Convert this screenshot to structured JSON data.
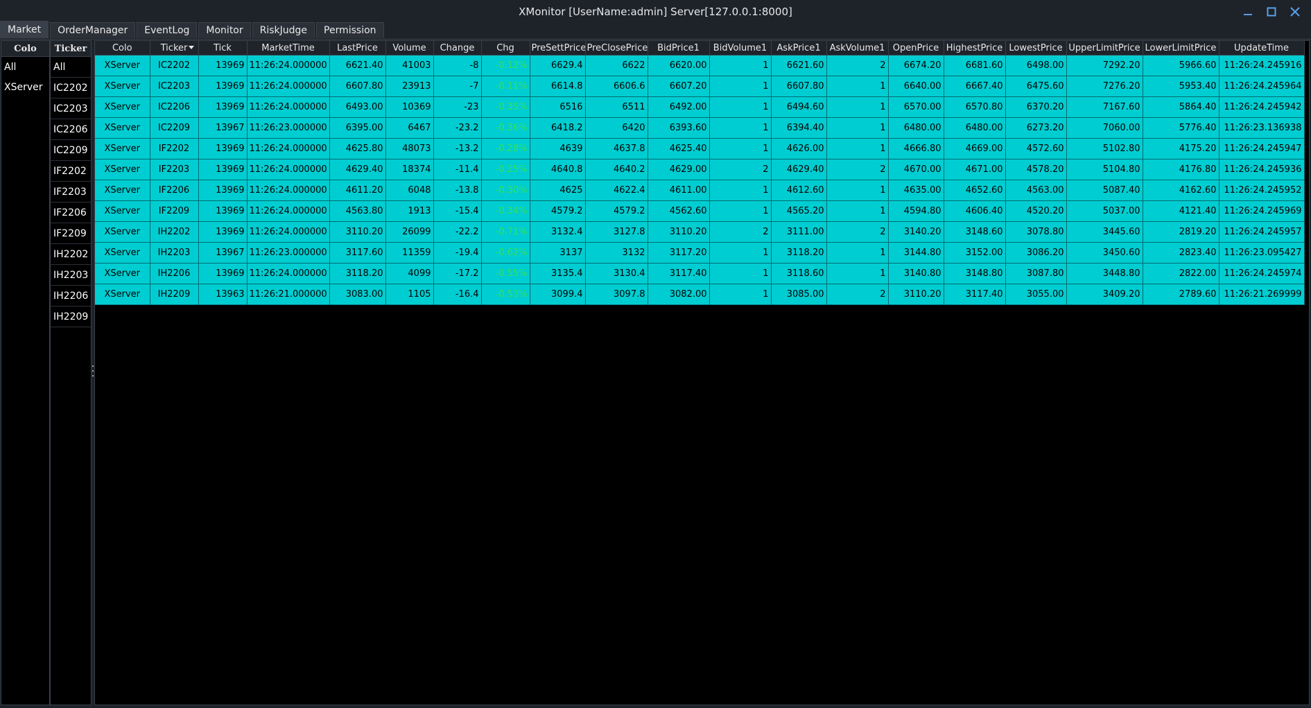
{
  "window": {
    "title": "XMonitor [UserName:admin] Server[127.0.0.1:8000]"
  },
  "tabs": [
    {
      "label": "Market",
      "active": true
    },
    {
      "label": "OrderManager",
      "active": false
    },
    {
      "label": "EventLog",
      "active": false
    },
    {
      "label": "Monitor",
      "active": false
    },
    {
      "label": "RiskJudge",
      "active": false
    },
    {
      "label": "Permission",
      "active": false
    }
  ],
  "colo_filter": {
    "header": "Colo",
    "items": [
      "All",
      "XServer"
    ]
  },
  "ticker_filter": {
    "header": "Ticker",
    "items": [
      "All",
      "IC2202",
      "IC2203",
      "IC2206",
      "IC2209",
      "IF2202",
      "IF2203",
      "IF2206",
      "IF2209",
      "IH2202",
      "IH2203",
      "IH2206",
      "IH2209"
    ]
  },
  "market_table": {
    "sorted_column": "Ticker",
    "columns": [
      "Colo",
      "Ticker",
      "Tick",
      "MarketTime",
      "LastPrice",
      "Volume",
      "Change",
      "Chg",
      "PreSettPrice",
      "PreClosePrice",
      "BidPrice1",
      "BidVolume1",
      "AskPrice1",
      "AskVolume1",
      "OpenPrice",
      "HighestPrice",
      "LowestPrice",
      "UpperLimitPrice",
      "LowerLimitPrice",
      "UpdateTime"
    ],
    "rows": [
      [
        "XServer",
        "IC2202",
        "13969",
        "11:26:24.000000",
        "6621.40",
        "41003",
        "-8",
        "-0.12%",
        "6629.4",
        "6622",
        "6620.00",
        "1",
        "6621.60",
        "2",
        "6674.20",
        "6681.60",
        "6498.00",
        "7292.20",
        "5966.60",
        "11:26:24.245916"
      ],
      [
        "XServer",
        "IC2203",
        "13969",
        "11:26:24.000000",
        "6607.80",
        "23913",
        "-7",
        "-0.11%",
        "6614.8",
        "6606.6",
        "6607.20",
        "1",
        "6607.80",
        "1",
        "6640.00",
        "6667.40",
        "6475.60",
        "7276.20",
        "5953.40",
        "11:26:24.245964"
      ],
      [
        "XServer",
        "IC2206",
        "13969",
        "11:26:24.000000",
        "6493.00",
        "10369",
        "-23",
        "-0.35%",
        "6516",
        "6511",
        "6492.00",
        "1",
        "6494.60",
        "1",
        "6570.00",
        "6570.80",
        "6370.20",
        "7167.60",
        "5864.40",
        "11:26:24.245942"
      ],
      [
        "XServer",
        "IC2209",
        "13967",
        "11:26:23.000000",
        "6395.00",
        "6467",
        "-23.2",
        "-0.36%",
        "6418.2",
        "6420",
        "6393.60",
        "1",
        "6394.40",
        "1",
        "6480.00",
        "6480.00",
        "6273.20",
        "7060.00",
        "5776.40",
        "11:26:23.136938"
      ],
      [
        "XServer",
        "IF2202",
        "13969",
        "11:26:24.000000",
        "4625.80",
        "48073",
        "-13.2",
        "-0.28%",
        "4639",
        "4637.8",
        "4625.40",
        "1",
        "4626.00",
        "1",
        "4666.80",
        "4669.00",
        "4572.60",
        "5102.80",
        "4175.20",
        "11:26:24.245947"
      ],
      [
        "XServer",
        "IF2203",
        "13969",
        "11:26:24.000000",
        "4629.40",
        "18374",
        "-11.4",
        "-0.25%",
        "4640.8",
        "4640.2",
        "4629.00",
        "2",
        "4629.40",
        "2",
        "4670.00",
        "4671.00",
        "4578.20",
        "5104.80",
        "4176.80",
        "11:26:24.245936"
      ],
      [
        "XServer",
        "IF2206",
        "13969",
        "11:26:24.000000",
        "4611.20",
        "6048",
        "-13.8",
        "-0.30%",
        "4625",
        "4622.4",
        "4611.00",
        "1",
        "4612.60",
        "1",
        "4635.00",
        "4652.60",
        "4563.00",
        "5087.40",
        "4162.60",
        "11:26:24.245952"
      ],
      [
        "XServer",
        "IF2209",
        "13969",
        "11:26:24.000000",
        "4563.80",
        "1913",
        "-15.4",
        "-0.34%",
        "4579.2",
        "4579.2",
        "4562.60",
        "1",
        "4565.20",
        "1",
        "4594.80",
        "4606.40",
        "4520.20",
        "5037.00",
        "4121.40",
        "11:26:24.245969"
      ],
      [
        "XServer",
        "IH2202",
        "13969",
        "11:26:24.000000",
        "3110.20",
        "26099",
        "-22.2",
        "-0.71%",
        "3132.4",
        "3127.8",
        "3110.20",
        "2",
        "3111.00",
        "2",
        "3140.20",
        "3148.60",
        "3078.80",
        "3445.60",
        "2819.20",
        "11:26:24.245957"
      ],
      [
        "XServer",
        "IH2203",
        "13967",
        "11:26:23.000000",
        "3117.60",
        "11359",
        "-19.4",
        "-0.62%",
        "3137",
        "3132",
        "3117.20",
        "1",
        "3118.20",
        "1",
        "3144.80",
        "3152.00",
        "3086.20",
        "3450.60",
        "2823.40",
        "11:26:23.095427"
      ],
      [
        "XServer",
        "IH2206",
        "13969",
        "11:26:24.000000",
        "3118.20",
        "4099",
        "-17.2",
        "-0.55%",
        "3135.4",
        "3130.4",
        "3117.40",
        "1",
        "3118.60",
        "1",
        "3140.80",
        "3148.80",
        "3087.80",
        "3448.80",
        "2822.00",
        "11:26:24.245974"
      ],
      [
        "XServer",
        "IH2209",
        "13963",
        "11:26:21.000000",
        "3083.00",
        "1105",
        "-16.4",
        "-0.53%",
        "3099.4",
        "3097.8",
        "3082.00",
        "1",
        "3085.00",
        "2",
        "3110.20",
        "3117.40",
        "3055.00",
        "3409.20",
        "2789.60",
        "11:26:21.269999"
      ]
    ]
  },
  "colors": {
    "row_background": "#00cdd1",
    "chg_text": "#33e05a",
    "panel_background": "#000000",
    "window_background": "#1e232a"
  }
}
